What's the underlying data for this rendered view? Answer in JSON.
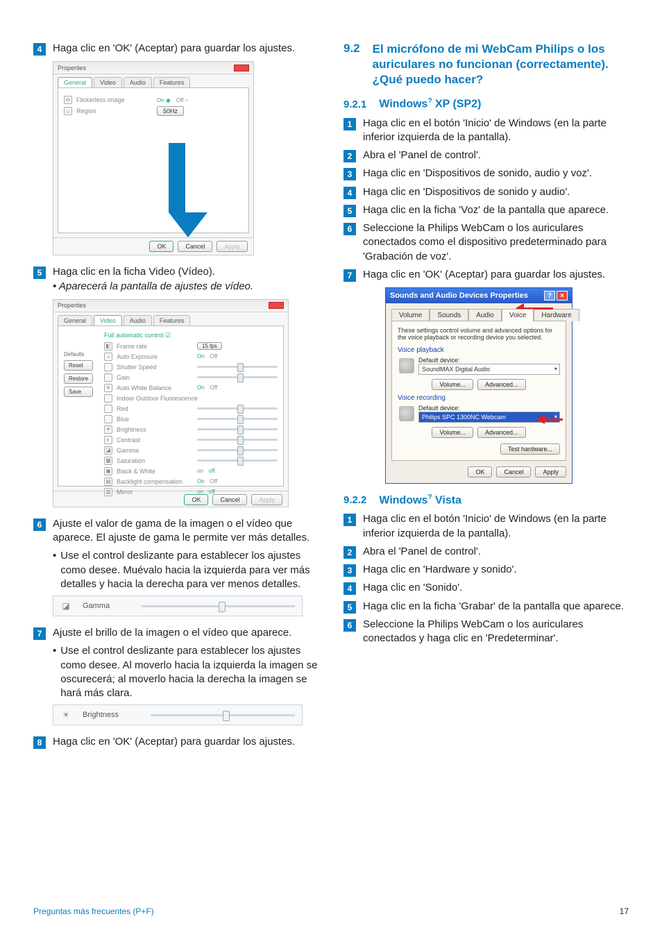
{
  "left": {
    "step4": "Haga clic en 'OK' (Aceptar) para guardar los ajustes.",
    "shot1": {
      "title": "Properties",
      "tabs": [
        "General",
        "Video",
        "Audio",
        "Features"
      ],
      "rows": [
        {
          "icon": "⟳",
          "label": "Flickerless image",
          "on": "On",
          "off": "Off"
        },
        {
          "icon": "⌂",
          "label": "Region",
          "value": "50Hz"
        }
      ],
      "buttons": {
        "ok": "OK",
        "cancel": "Cancel",
        "apply": "Apply"
      }
    },
    "step5": "Haga clic en la ficha Video (Vídeo).",
    "step5_italic": "• Aparecerá la pantalla de ajustes de vídeo.",
    "shot2": {
      "title": "Properties",
      "tabs": [
        "General",
        "Video",
        "Audio",
        "Features"
      ],
      "full_auto": "Full automatic control",
      "left_buttons": {
        "defaults": "Defaults",
        "reset": "Reset",
        "restore": "Restore",
        "save": "Save"
      },
      "rows": [
        {
          "icon": "◧",
          "label": "Frame rate",
          "extra": "15 fps"
        },
        {
          "icon": "☼",
          "label": "Auto Exposure",
          "on": "On",
          "off": "Off"
        },
        {
          "icon": "",
          "label": "Shutter Speed"
        },
        {
          "icon": "",
          "label": "Gain"
        },
        {
          "icon": "✳",
          "label": "Auto White Balance",
          "on": "On",
          "off": "Off"
        },
        {
          "icon": "",
          "label": "Indoor   Outdoor   Fluorescence"
        },
        {
          "icon": "",
          "label": "Red"
        },
        {
          "icon": "",
          "label": "Blue"
        },
        {
          "icon": "☀",
          "label": "Brightness"
        },
        {
          "icon": "◐",
          "label": "Contrast"
        },
        {
          "icon": "◪",
          "label": "Gamma"
        },
        {
          "icon": "▦",
          "label": "Saturation"
        },
        {
          "icon": "▣",
          "label": "Black & White",
          "on": "on",
          "off": "off"
        },
        {
          "icon": "▤",
          "label": "Backlight compensation",
          "on": "On",
          "off": "Off"
        },
        {
          "icon": "▥",
          "label": "Mirror",
          "on": "on",
          "off": "off"
        }
      ],
      "buttons": {
        "ok": "OK",
        "cancel": "Cancel",
        "apply": "Apply"
      }
    },
    "step6": "Ajuste el valor de gama de la imagen o el vídeo que aparece. El ajuste de gama le permite ver más detalles.",
    "step6_bullet": "Use el control deslizante para establecer los ajustes como desee. Muévalo hacia la izquierda para ver más detalles y hacia la derecha para ver menos detalles.",
    "gamma_strip": {
      "label": "Gamma"
    },
    "step7": "Ajuste el brillo de la imagen o el vídeo que aparece.",
    "step7_bullet": "Use el control deslizante para establecer los ajustes como desee.  Al moverlo hacia la izquierda la imagen se oscurecerá; al moverlo hacia la derecha la imagen se hará más clara.",
    "brightness_strip": {
      "label": "Brightness"
    },
    "step8": "Haga clic en 'OK' (Aceptar) para guardar los ajustes."
  },
  "right": {
    "sec_num": "9.2",
    "sec_title": "El micrófono de mi WebCam Philips o los auriculares no funcionan (correctamente). ¿Qué puedo hacer?",
    "sub1_num": "9.2.1",
    "sub1_title_a": "Windows",
    "sub1_title_b": " XP (SP2)",
    "xp_steps": {
      "s1": "Haga clic en el botón 'Inicio' de Windows (en la parte inferior izquierda de la pantalla).",
      "s2": "Abra el 'Panel de control'.",
      "s3": "Haga clic en 'Dispositivos de sonido, audio y voz'.",
      "s4": "Haga clic en 'Dispositivos de sonido y audio'.",
      "s5": "Haga clic en la ficha 'Voz' de la pantalla que aparece.",
      "s6": "Seleccione la Philips WebCam o los auriculares conectados como el dispositivo predeterminado para 'Grabación de voz'.",
      "s7": "Haga clic en 'OK' (Aceptar) para guardar los ajustes."
    },
    "xp_dialog": {
      "title": "Sounds and Audio Devices Properties",
      "tabs": [
        "Volume",
        "Sounds",
        "Audio",
        "Voice",
        "Hardware"
      ],
      "note": "These settings control volume and advanced options for the voice playback or recording device you selected.",
      "g1": "Voice playback",
      "g1_default": "Default device:",
      "g1_value": "SoundMAX Digital Audio",
      "g2": "Voice recording",
      "g2_default": "Default device:",
      "g2_value": "Philips SPC 1300NC Webcam",
      "btn_volume": "Volume...",
      "btn_advanced": "Advanced...",
      "btn_test": "Test hardware...",
      "btn_ok": "OK",
      "btn_cancel": "Cancel",
      "btn_apply": "Apply"
    },
    "sub2_num": "9.2.2",
    "sub2_title_a": "Windows",
    "sub2_title_b": " Vista",
    "vista_steps": {
      "s1": "Haga clic en el botón 'Inicio' de Windows (en la parte inferior izquierda de la pantalla).",
      "s2": "Abra el 'Panel de control'.",
      "s3": "Haga clic en 'Hardware y sonido'.",
      "s4": "Haga clic en 'Sonido'.",
      "s5": "Haga clic en la ficha 'Grabar' de la pantalla que aparece.",
      "s6": "Seleccione la Philips WebCam o los auriculares conectados y haga clic en 'Predeterminar'."
    }
  },
  "footer": {
    "left": "Preguntas más frecuentes (P+F)",
    "right": "17"
  }
}
